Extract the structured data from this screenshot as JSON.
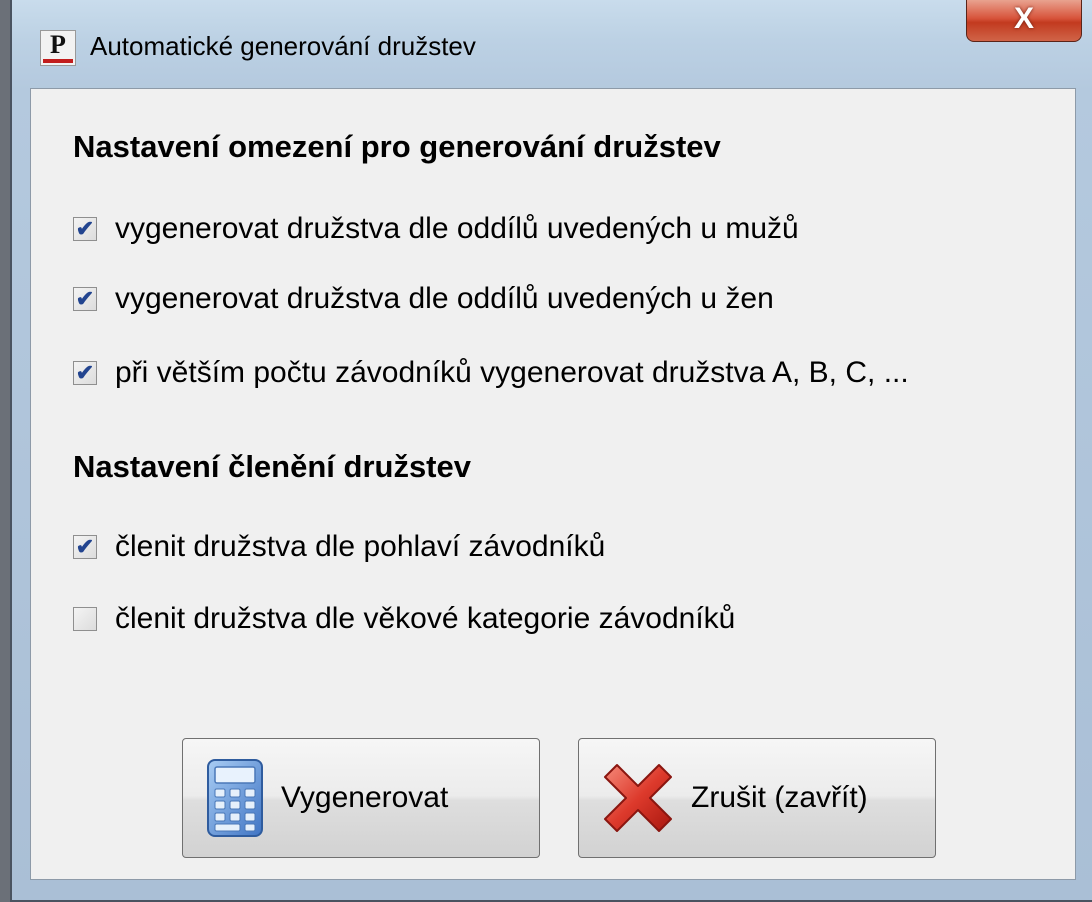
{
  "window": {
    "title": "Automatické generování družstev",
    "app_icon_letter": "P",
    "close_label": "X"
  },
  "section1": {
    "title": "Nastavení omezení pro generování družstev",
    "options": [
      {
        "label": "vygenerovat družstva dle oddílů uvedených u mužů",
        "checked": true
      },
      {
        "label": "vygenerovat družstva dle oddílů uvedených u žen",
        "checked": true
      },
      {
        "label": "při větším počtu závodníků vygenerovat družstva A, B, C, ...",
        "checked": true
      }
    ]
  },
  "section2": {
    "title": "Nastavení členění družstev",
    "options": [
      {
        "label": "členit družstva dle pohlaví závodníků",
        "checked": true
      },
      {
        "label": "členit družstva dle věkové kategorie závodníků",
        "checked": false
      }
    ]
  },
  "buttons": {
    "generate": {
      "label": "Vygenerovat",
      "icon": "calculator-icon"
    },
    "cancel": {
      "label": "Zrušit (zavřít)",
      "icon": "red-x-icon"
    }
  },
  "colors": {
    "checkmark": "#22448f",
    "close_button": "#c8432a",
    "cancel_icon": "#d9342b",
    "calculator": "#5b8fd6"
  }
}
